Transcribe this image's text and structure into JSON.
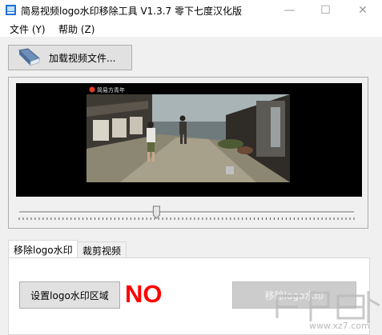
{
  "window": {
    "title": "简易视频logo水印移除工具 V1.3.7 零下七度汉化版",
    "minimize_glyph": "—",
    "maximize_glyph": "☐",
    "close_glyph": "✕"
  },
  "menu": {
    "items": [
      {
        "label": "文件 (Y)"
      },
      {
        "label": "帮助 (Z)"
      }
    ]
  },
  "toolbar": {
    "load_video_label": "加载视频文件...",
    "load_icon": "book-icon"
  },
  "video": {
    "overlay_logo_text": "简易方青年"
  },
  "slider": {
    "position_fraction": 0.41
  },
  "tabs": [
    {
      "label": "移除logo水印",
      "active": true
    },
    {
      "label": "裁剪视频",
      "active": false
    }
  ],
  "panel": {
    "set_region_label": "设置logo水印区域",
    "status_text": "NO",
    "remove_label": "移除logo水印"
  },
  "watermark": {
    "site_text": "www.xz7.com"
  },
  "colors": {
    "status": "#ff0000",
    "video_bg": "#000000"
  }
}
